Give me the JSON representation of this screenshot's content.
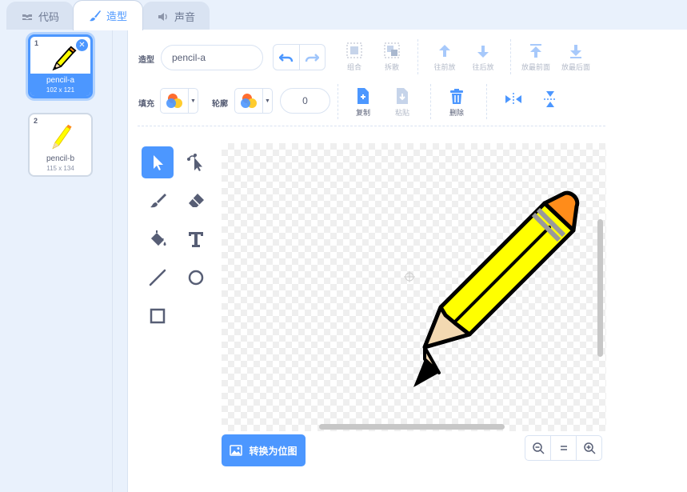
{
  "tabs": [
    {
      "label": "代码",
      "icon": "code-icon"
    },
    {
      "label": "造型",
      "icon": "brush-icon"
    },
    {
      "label": "声音",
      "icon": "speaker-icon"
    }
  ],
  "costumes": [
    {
      "index": "1",
      "name": "pencil-a",
      "size": "102 x 121",
      "selected": true
    },
    {
      "index": "2",
      "name": "pencil-b",
      "size": "115 x 134",
      "selected": false
    }
  ],
  "editor": {
    "costume_label": "造型",
    "costume_name": "pencil-a",
    "fill_label": "填充",
    "outline_label": "轮廓",
    "outline_width": "0",
    "group_label": "组合",
    "ungroup_label": "拆散",
    "forward_label": "往前放",
    "backward_label": "往后放",
    "front_label": "放最前面",
    "back_label": "放最后面",
    "copy_label": "复制",
    "paste_label": "粘贴",
    "delete_label": "删除",
    "bitmap_button": "转换为位图"
  },
  "colors": {
    "accent": "#4c97ff",
    "pencil_body": "#ffff00",
    "pencil_eraser": "#ff8c1a",
    "text": "#575e75"
  }
}
